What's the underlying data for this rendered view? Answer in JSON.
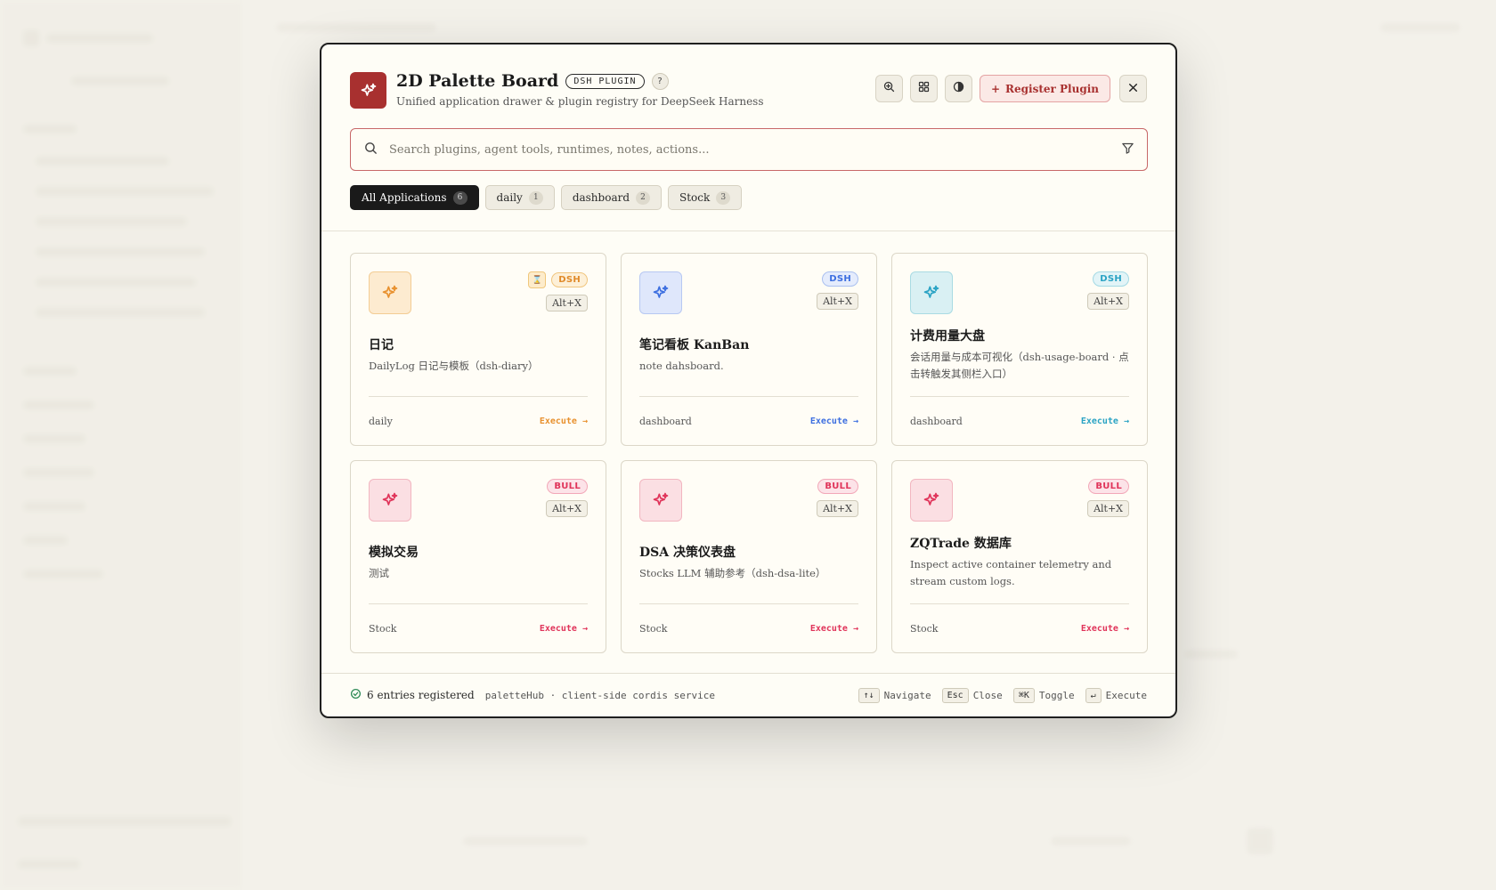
{
  "header": {
    "title": "2D Palette Board",
    "badge": "DSH PLUGIN",
    "help_label": "?",
    "subtitle": "Unified application drawer & plugin registry for DeepSeek Harness",
    "register_label": "Register Plugin",
    "register_prefix": "+"
  },
  "search": {
    "value": "",
    "placeholder": "Search plugins, agent tools, runtimes, notes, actions..."
  },
  "tabs": [
    {
      "label": "All Applications",
      "count": "6"
    },
    {
      "label": "daily",
      "count": "1"
    },
    {
      "label": "dashboard",
      "count": "2"
    },
    {
      "label": "Stock",
      "count": "3"
    }
  ],
  "cards": [
    {
      "title": "日记",
      "desc": "DailyLog 日记与模板（dsh-diary）",
      "badge": "DSH",
      "mini": "⌛",
      "shortcut": "Alt+X",
      "tag": "daily",
      "execute": "Execute →"
    },
    {
      "title": "笔记看板 KanBan",
      "desc": "note dahsboard.",
      "badge": "DSH",
      "shortcut": "Alt+X",
      "tag": "dashboard",
      "execute": "Execute →"
    },
    {
      "title": "计费用量大盘",
      "desc": "会话用量与成本可视化（dsh-usage-board · 点击转触发其侧栏入口）",
      "badge": "DSH",
      "shortcut": "Alt+X",
      "tag": "dashboard",
      "execute": "Execute →"
    },
    {
      "title": "模拟交易",
      "desc": "测试",
      "badge": "BULL",
      "shortcut": "Alt+X",
      "tag": "Stock",
      "execute": "Execute →"
    },
    {
      "title": "DSA 决策仪表盘",
      "desc": "Stocks LLM 辅助参考（dsh-dsa-lite）",
      "badge": "BULL",
      "shortcut": "Alt+X",
      "tag": "Stock",
      "execute": "Execute →"
    },
    {
      "title": "ZQTrade 数据库",
      "desc": "Inspect active container telemetry and stream custom logs.",
      "badge": "BULL",
      "shortcut": "Alt+X",
      "tag": "Stock",
      "execute": "Execute →"
    }
  ],
  "footer": {
    "status": "6 entries registered",
    "service": "paletteHub · client-side cordis service",
    "hints": [
      {
        "key": "↑↓",
        "label": "Navigate"
      },
      {
        "key": "Esc",
        "label": "Close"
      },
      {
        "key": "⌘K",
        "label": "Toggle"
      },
      {
        "key": "↵",
        "label": "Execute"
      }
    ]
  },
  "colors": {
    "brand": "#a8302f",
    "orange": "#e8912f",
    "blue": "#3d6fe0",
    "teal": "#2aa3c4",
    "pink": "#e0345a"
  }
}
